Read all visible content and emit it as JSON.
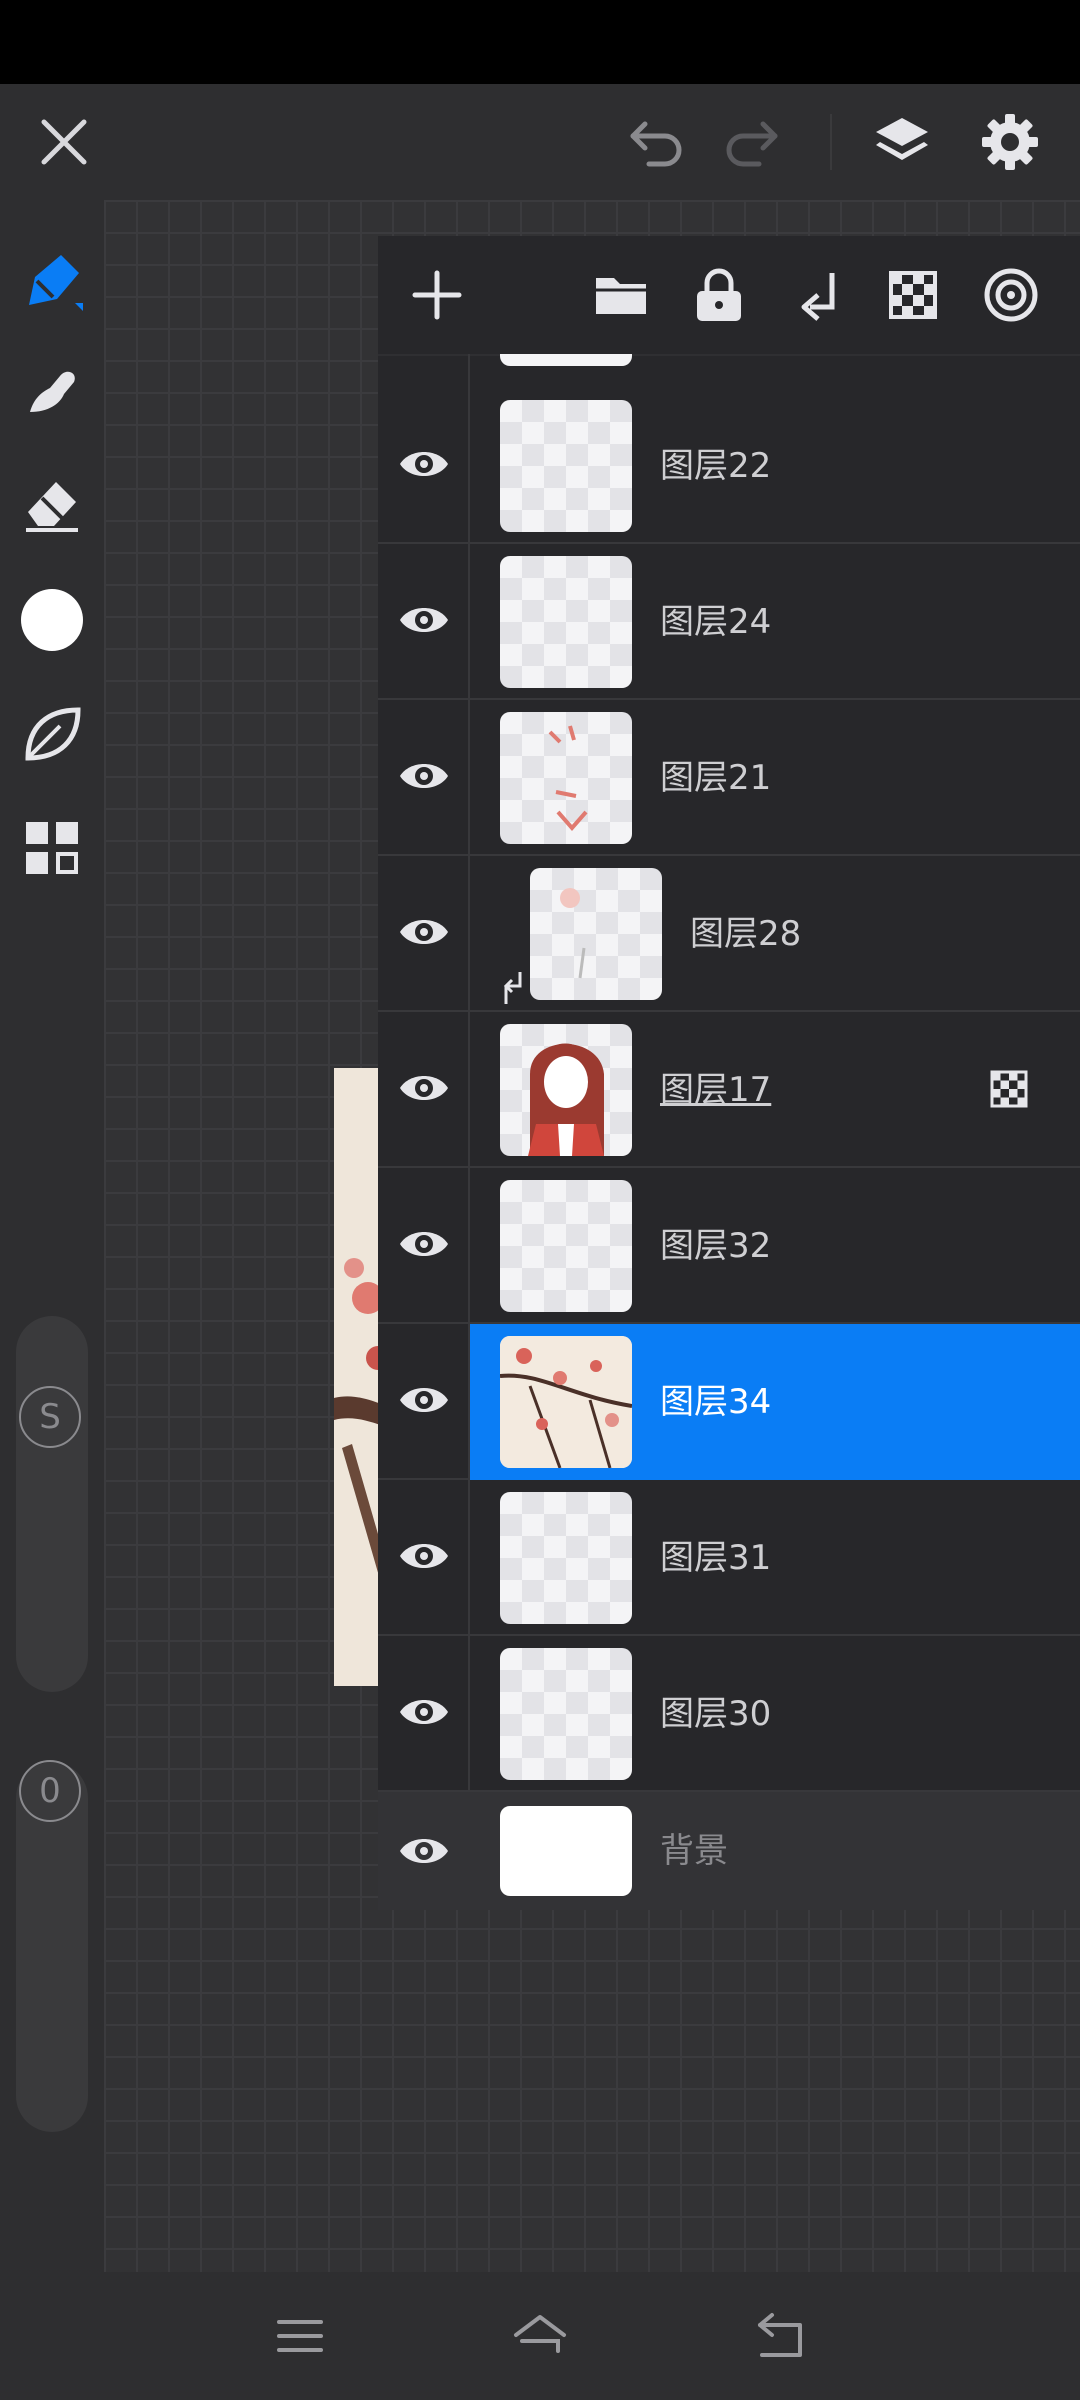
{
  "layers": {
    "items": [
      {
        "name": "图层22"
      },
      {
        "name": "图层24"
      },
      {
        "name": "图层21"
      },
      {
        "name": "图层28"
      },
      {
        "name": "图层17"
      },
      {
        "name": "图层32"
      },
      {
        "name": "图层34",
        "selected": true
      },
      {
        "name": "图层31"
      },
      {
        "name": "图层30"
      },
      {
        "name": "背景"
      }
    ]
  },
  "sliders": {
    "size_label": "S",
    "opacity_label": "0"
  },
  "colors": {
    "accent": "#0a7df5",
    "panel": "#27272a",
    "toolbar": "#2e2e30",
    "current_color": "#ffffff"
  },
  "icons": {
    "top_bar": [
      "close-icon",
      "undo-icon",
      "redo-icon",
      "layers-icon",
      "settings-icon"
    ],
    "tools": [
      "pen-icon",
      "smudge-icon",
      "eraser-icon",
      "color-swatch-icon",
      "leaf-icon",
      "gallery-icon"
    ],
    "layer_toolbar": [
      "add-icon",
      "folder-icon",
      "lock-icon",
      "clip-mask-icon",
      "alpha-lock-icon",
      "blend-icon"
    ],
    "nav": [
      "menu-icon",
      "home-icon",
      "back-icon"
    ]
  }
}
